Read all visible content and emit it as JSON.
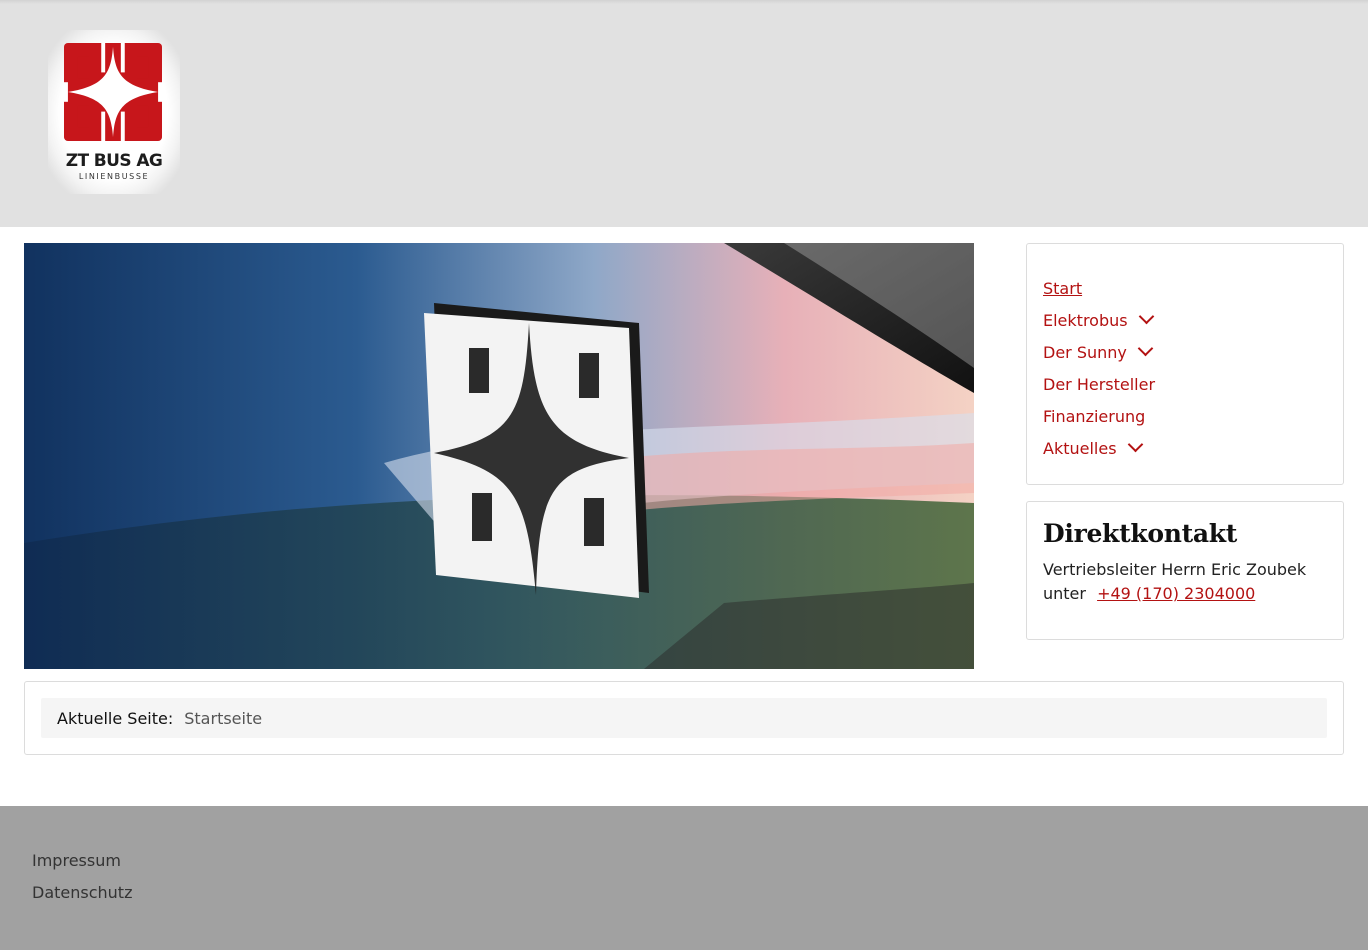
{
  "brand": {
    "name": "ZT BUS AG",
    "tagline": "LINIENBUSSE",
    "color": "#c7161b"
  },
  "nav": {
    "items": [
      {
        "label": "Start",
        "active": true,
        "has_submenu": false
      },
      {
        "label": "Elektrobus",
        "active": false,
        "has_submenu": true
      },
      {
        "label": "Der Sunny",
        "active": false,
        "has_submenu": true
      },
      {
        "label": "Der Hersteller",
        "active": false,
        "has_submenu": false
      },
      {
        "label": "Finanzierung",
        "active": false,
        "has_submenu": false
      },
      {
        "label": "Aktuelles",
        "active": false,
        "has_submenu": true
      }
    ]
  },
  "contact": {
    "title": "Direktkontakt",
    "text_line1": "Vertriebsleiter Herrn Eric Zoubek",
    "text_line2": "unter",
    "phone": "+49 (170) 2304000"
  },
  "breadcrumb": {
    "label": "Aktuelle Seite:",
    "current": "Startseite"
  },
  "footer": {
    "links": [
      "Impressum",
      "Datenschutz"
    ]
  },
  "colors": {
    "link": "#b31212",
    "header_bg": "#e1e1e1",
    "footer_bg": "#a1a1a1"
  }
}
